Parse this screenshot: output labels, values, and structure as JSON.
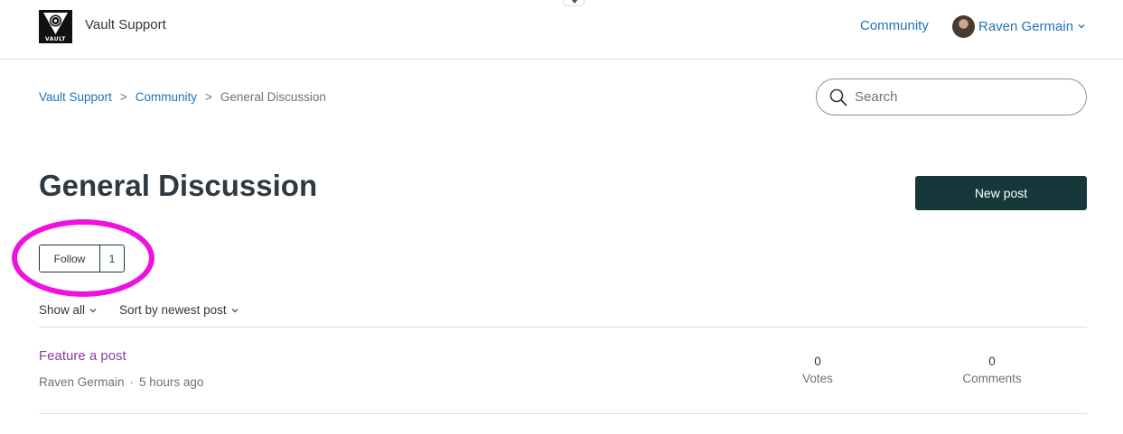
{
  "header": {
    "logo_text": "VAULT",
    "site_name": "Vault Support",
    "nav_community": "Community",
    "user_name": "Raven Germain"
  },
  "breadcrumb": {
    "items": [
      "Vault Support",
      "Community"
    ],
    "current": "General Discussion",
    "separator": ">"
  },
  "search": {
    "placeholder": "Search"
  },
  "page": {
    "title": "General Discussion",
    "new_post_label": "New post"
  },
  "follow": {
    "label": "Follow",
    "count": "1"
  },
  "filters": {
    "show": "Show all",
    "sort": "Sort by newest post"
  },
  "posts": [
    {
      "title": "Feature a post",
      "author": "Raven Germain",
      "separator": "·",
      "time": "5 hours ago",
      "votes": "0",
      "votes_label": "Votes",
      "comments": "0",
      "comments_label": "Comments"
    }
  ],
  "colors": {
    "link": "#1f73b7",
    "primary_button": "#17383b",
    "visited_post": "#8a3fa3",
    "highlight": "#f010e0"
  }
}
